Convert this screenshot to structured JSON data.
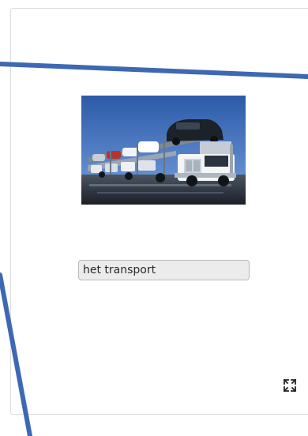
{
  "exercise": {
    "answer_value": "het transport",
    "image_subject": "car-carrier-truck-photo",
    "expand_icon": "expand-arrows-icon"
  },
  "colors": {
    "annotation_line": "#3d68b4",
    "input_background": "#ececec",
    "input_border": "#b9b9b9",
    "card_border": "#dcdcdc"
  }
}
